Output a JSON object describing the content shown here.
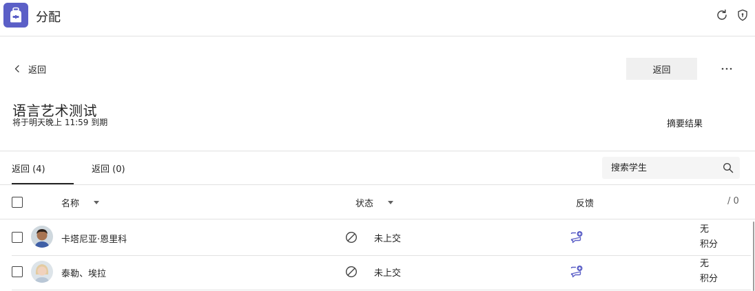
{
  "header": {
    "app_title": "分配",
    "app_icon": "backpack-icon",
    "accent": "#5b5fc7"
  },
  "nav": {
    "back_label": "返回",
    "return_button": "返回"
  },
  "assignment": {
    "title": "语言艺术测试",
    "due": "将于明天晚上 11:59 到期",
    "summary_link": "摘要结果"
  },
  "tabs": [
    {
      "label": "返回 (4)",
      "active": true
    },
    {
      "label": "返回 (0)",
      "active": false
    }
  ],
  "search": {
    "placeholder": "搜索学生"
  },
  "table": {
    "columns": {
      "name": "名称",
      "status": "状态",
      "feedback": "反馈",
      "points": "/ 0"
    },
    "rows": [
      {
        "name": "卡塔尼亚·恩里科",
        "status": "未上交",
        "points_line1": "无",
        "points_line2": "积分"
      },
      {
        "name": "泰勒、埃拉",
        "status": "未上交",
        "points_line1": "无",
        "points_line2": "积分"
      }
    ]
  }
}
